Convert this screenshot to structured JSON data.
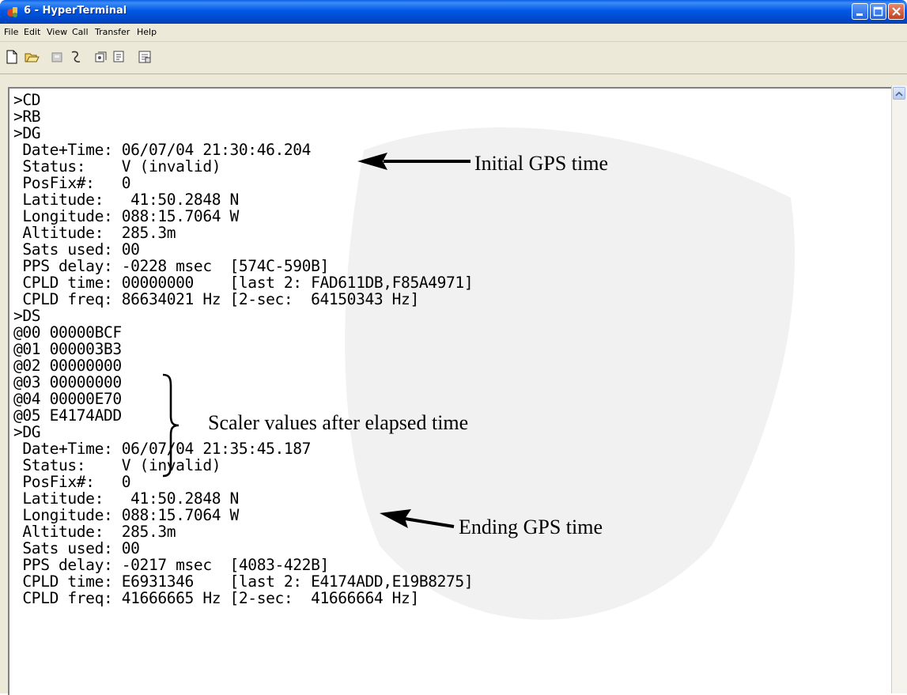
{
  "window": {
    "title": "6 - HyperTerminal",
    "colors": {
      "titlebar": "#0058e6",
      "close": "#c3421f",
      "chrome": "#ece9d8"
    }
  },
  "menu": [
    "File",
    "Edit",
    "View",
    "Call",
    "Transfer",
    "Help"
  ],
  "toolbar": {
    "icons": [
      "new-connection-icon",
      "open-icon",
      "disconnect-icon",
      "dial-icon",
      "send-icon",
      "receive-icon",
      "properties-icon"
    ]
  },
  "terminal": {
    "lines": [
      ">CD",
      ">RB",
      ">DG",
      " Date+Time: 06/07/04 21:30:46.204",
      " Status:    V (invalid)",
      " PosFix#:   0",
      " Latitude:   41:50.2848 N",
      " Longitude: 088:15.7064 W",
      " Altitude:  285.3m",
      " Sats used: 00",
      " PPS delay: -0228 msec  [574C-590B]",
      " CPLD time: 00000000    [last 2: FAD611DB,F85A4971]",
      " CPLD freq: 86634021 Hz [2-sec:  64150343 Hz]",
      ">DS",
      "@00 00000BCF",
      "@01 000003B3",
      "@02 00000000",
      "@03 00000000",
      "@04 00000E70",
      "@05 E4174ADD",
      ">DG",
      " Date+Time: 06/07/04 21:35:45.187",
      " Status:    V (invalid)",
      " PosFix#:   0",
      " Latitude:   41:50.2848 N",
      " Longitude: 088:15.7064 W",
      " Altitude:  285.3m",
      " Sats used: 00",
      " PPS delay: -0217 msec  [4083-422B]",
      " CPLD time: E6931346    [last 2: E4174ADD,E19B8275]",
      " CPLD freq: 41666665 Hz [2-sec:  41666664 Hz]"
    ]
  },
  "annotations": {
    "initial": "Initial GPS time",
    "scaler": "Scaler values after elapsed time",
    "ending": "Ending GPS time"
  }
}
